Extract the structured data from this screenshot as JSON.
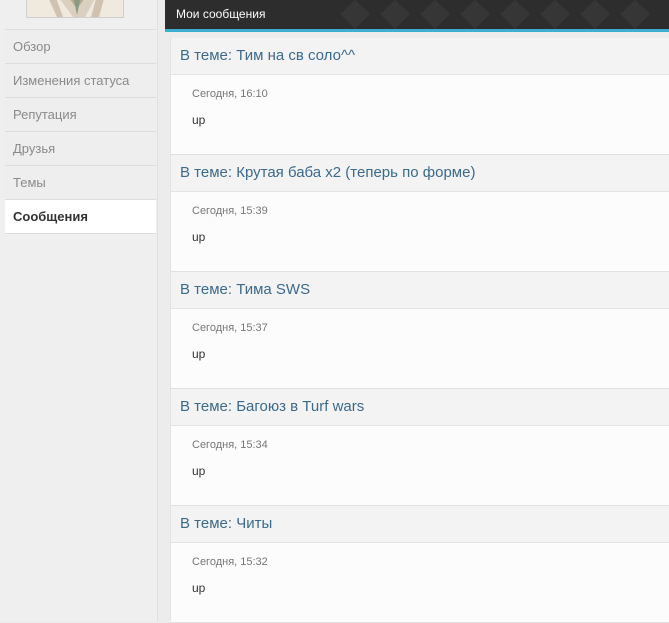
{
  "header": {
    "title": "Мои сообщения"
  },
  "sidebar": {
    "items": [
      {
        "label": "Обзор"
      },
      {
        "label": "Изменения статуса"
      },
      {
        "label": "Репутация"
      },
      {
        "label": "Друзья"
      },
      {
        "label": "Темы"
      },
      {
        "label": "Сообщения"
      }
    ],
    "active": "Сообщения"
  },
  "posts": [
    {
      "title": "В теме: Тим на св соло^^",
      "date": "Сегодня, 16:10",
      "text": "up"
    },
    {
      "title": "В теме: Крутая баба х2 (теперь по форме)",
      "date": "Сегодня, 15:39",
      "text": "up"
    },
    {
      "title": "В теме: Тима SWS",
      "date": "Сегодня, 15:37",
      "text": "up"
    },
    {
      "title": "В теме: Багоюз в Turf wars",
      "date": "Сегодня, 15:34",
      "text": "up"
    },
    {
      "title": "В теме: Читы",
      "date": "Сегодня, 15:32",
      "text": "up"
    }
  ],
  "colors": {
    "accent": "#3cafd0",
    "header_bg": "#2d2d2d",
    "link": "#3c6a8a"
  }
}
